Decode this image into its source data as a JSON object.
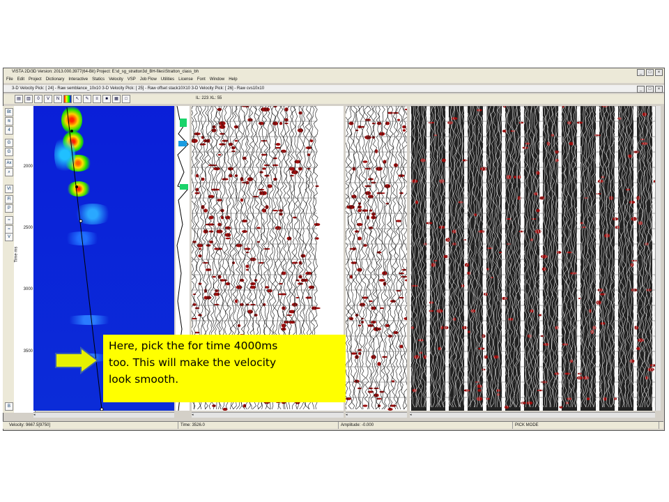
{
  "app": {
    "title": "VISTA 2D/3D Version: 2013.000.3977(64-Bit) Project: E:\\d_sg_stratton3d_BH-files\\Stratton_class_bh",
    "menu": [
      "File",
      "Edit",
      "Project",
      "Dictionary",
      "Interactive",
      "Statics",
      "Velocity",
      "VSP",
      "Job Flow",
      "Utilities",
      "License",
      "Font",
      "Window",
      "Help"
    ],
    "subwindow_title": "3-D Velocity Pick: [ 24] - Raw semblance_10x10 3-D Velocity Pick: [ 25] - Raw offset stack10X10 3-D Velocity Pick: [ 26] - Raw cvs10x10",
    "ilxl_readout": "IL: 223 XL: 55"
  },
  "axis": {
    "label": "Time ms",
    "ticks": [
      "2000",
      "2500",
      "3000",
      "3500"
    ]
  },
  "status": {
    "velocity": "Velocity:  9667.5[9750]",
    "time": "Time: 3526.0",
    "amplitude": "Amplitude:   -0.000",
    "mode": "PICK MODE"
  },
  "callout": {
    "line1": "Here, pick the for time 4000ms",
    "line2": "too. This will make the velocity",
    "line3": "look smooth."
  },
  "colors": {
    "callout_bg": "#ffff00",
    "arrow_fill": "#e6f000",
    "arrow_stroke": "#3a5fb0",
    "semblance_bg": "#0a22d6",
    "wiggle_red": "#9b0d0d"
  },
  "icons": {
    "toolbar": [
      "open-icon",
      "save-icon",
      "zero-icon",
      "v-icon",
      "n-icon",
      "color-icon",
      "pick-icon",
      "pencil-icon",
      "layers-icon",
      "stop-icon",
      "grid-icon",
      "box-icon"
    ],
    "left": [
      "bt-icon",
      "nmo-icon",
      "stack-icon",
      "g-icon",
      "gather-icon",
      "ax-icon",
      "zoom-icon",
      "vi-icon",
      "fill-icon",
      "picks-icon",
      "blue-icon",
      "cyan-icon",
      "b-icon"
    ]
  }
}
